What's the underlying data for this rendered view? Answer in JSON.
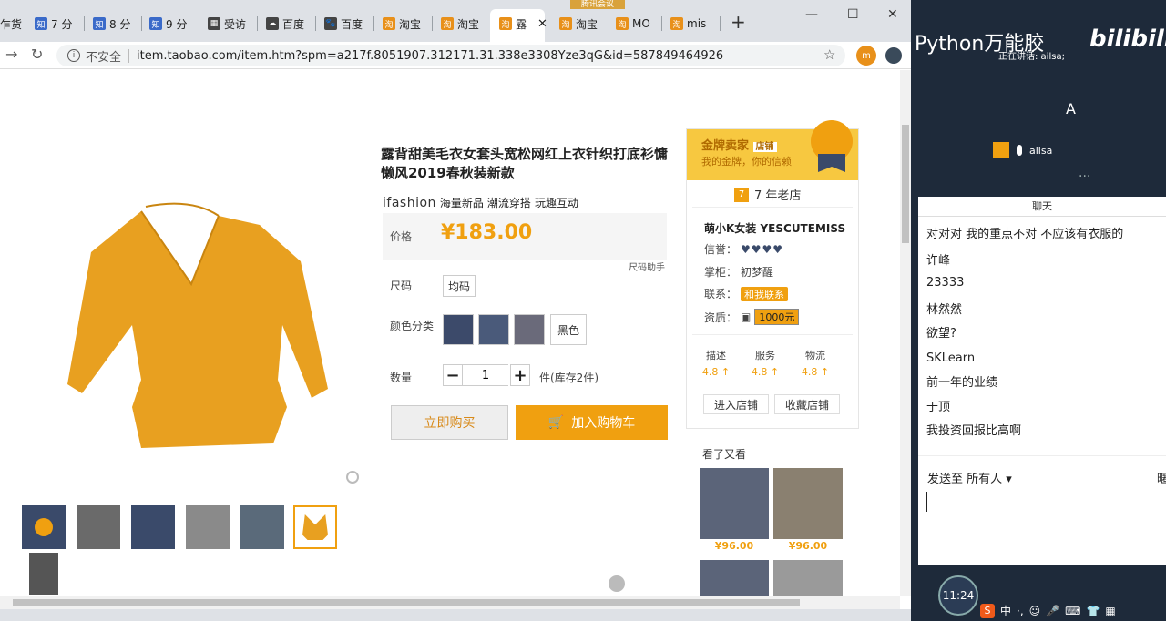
{
  "browser": {
    "tabs": [
      {
        "icon": "知",
        "label": "乍货"
      },
      {
        "icon": "知",
        "label": "7 分"
      },
      {
        "icon": "知",
        "label": "8 分"
      },
      {
        "icon": "知",
        "label": "9 分"
      },
      {
        "icon": "▦",
        "label": "受访"
      },
      {
        "icon": "☁",
        "label": "百度"
      },
      {
        "icon": "🐾",
        "label": "百度"
      },
      {
        "icon": "淘",
        "label": "淘宝"
      },
      {
        "icon": "淘",
        "label": "淘宝"
      },
      {
        "icon": "淘",
        "label": "露"
      },
      {
        "icon": "淘",
        "label": "淘宝"
      },
      {
        "icon": "淘",
        "label": "MO"
      },
      {
        "icon": "淘",
        "label": "mis"
      }
    ],
    "tooltip": "腾讯会议",
    "insecure_label": "不安全",
    "url": "item.taobao.com/item.htm?spm=a217f.8051907.312171.31.338e3308Yze3qG&id=587849464926",
    "profile_initial": "m"
  },
  "product": {
    "title": "露背甜美毛衣女套头宽松网红上衣针织打底衫慵懒风2019春秋装新款",
    "brand_logo": "ifashion",
    "brand_tags": [
      "海量新品",
      "潮流穿搭",
      "玩趣互动"
    ],
    "price_label": "价格",
    "price": "¥183.00",
    "size_chart": "尺码助手",
    "size_label": "尺码",
    "size_value": "均码",
    "color_label": "颜色分类",
    "color_black": "黑色",
    "qty_label": "数量",
    "qty_minus": "−",
    "qty_value": "1",
    "qty_plus": "+",
    "stock": "件(库存2件)",
    "buy_label": "立即购买",
    "cart_label": "加入购物车"
  },
  "shop": {
    "gold_title": "金牌卖家",
    "gold_badge": "店铺",
    "gold_sub": "我的金牌，你的信赖",
    "years_icon": "7",
    "years": "7 年老店",
    "name": "萌小K女装 YESCUTEMISS",
    "credit_label": "信誉：",
    "credit_hearts": "♥♥♥♥",
    "owner_label": "掌柜：",
    "owner": "初梦醒",
    "contact_label": "联系：",
    "contact": "和我联系",
    "qual_label": "资质：",
    "deposit": "1000元",
    "scores": [
      {
        "label": "描述",
        "value": "4.8 ↑"
      },
      {
        "label": "服务",
        "value": "4.8 ↑"
      },
      {
        "label": "物流",
        "value": "4.8 ↑"
      }
    ],
    "enter_shop": "进入店铺",
    "fav_shop": "收藏店铺",
    "recs_title": "看了又看",
    "rec_prices": [
      "¥96.00",
      "¥96.00"
    ]
  },
  "live": {
    "title": "Python万能胶",
    "bili": "bilibili",
    "speaking": "正在讲话: ailsa;",
    "big_letter": "A",
    "user": "ailsa",
    "chat_header": "聊天",
    "messages": [
      "对对对 我的重点不对 不应该有衣服的",
      "许峰",
      "23333",
      "林然然",
      "欲望?",
      "SKLearn",
      "前一年的业绩",
      "于顶",
      "我投资回报比高啊"
    ],
    "send_to": "发送至 所有人 ▾",
    "send_right": "暱",
    "clock": "11:24",
    "tray": [
      "S",
      "中",
      "·,",
      "☺",
      "🎤",
      "⌨",
      "👕",
      "▦"
    ]
  },
  "colors": {
    "accent": "#f0a010",
    "gold": "#f7c840",
    "panel": "#1e2a3a"
  }
}
